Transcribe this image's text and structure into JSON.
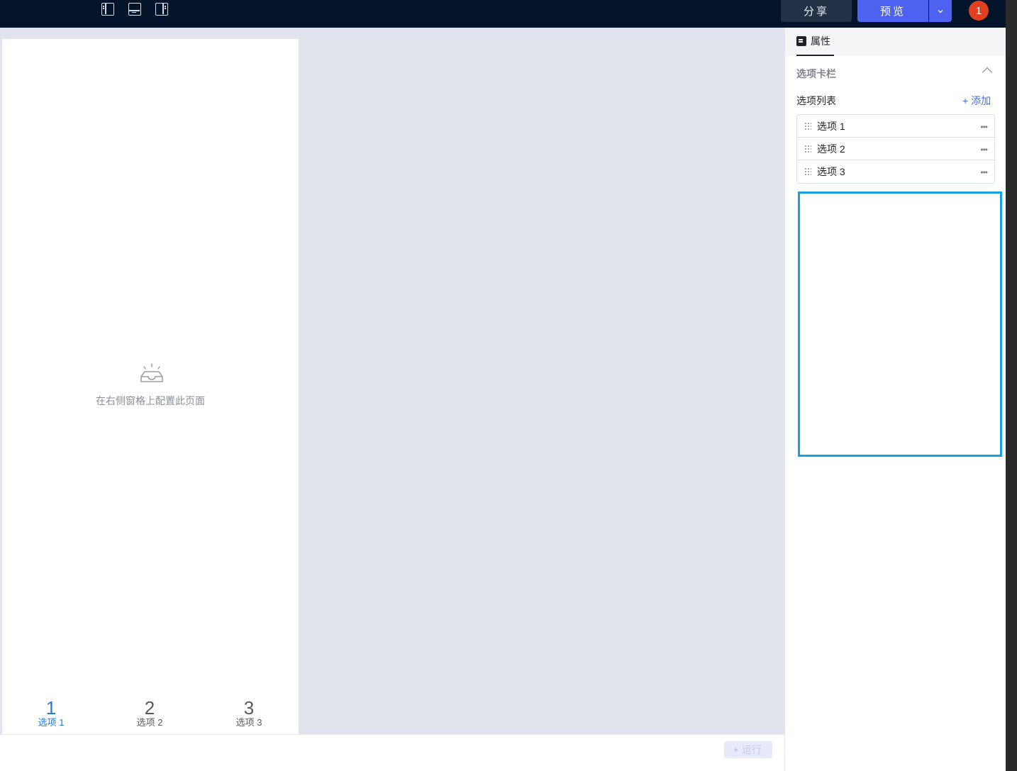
{
  "topbar": {
    "layout_icons": [
      "layout-left-panel-icon",
      "layout-bottom-panel-icon",
      "layout-right-panel-icon"
    ],
    "share_label": "分享",
    "preview_label": "预览",
    "preview_dropdown_icon": "chevron-down-icon",
    "avatar_text": "1",
    "colors": {
      "background": "#03142b",
      "primary": "#4d62f0",
      "avatar": "#e0401f"
    }
  },
  "canvas": {
    "empty_icon": "inbox-icon",
    "empty_text": "在右侧窗格上配置此页面",
    "tabbar": [
      {
        "num": "1",
        "label": "选项 1",
        "active": true
      },
      {
        "num": "2",
        "label": "选项 2",
        "active": false
      },
      {
        "num": "3",
        "label": "选项 3",
        "active": false
      }
    ],
    "accent_color": "#1e7be6"
  },
  "bottom_bar": {
    "run_label": "运行",
    "run_icon": "play-icon"
  },
  "right_panel": {
    "tab_label": "属性",
    "tab_icon": "properties-icon",
    "section_title": "选项卡栏",
    "collapse_icon": "chevron-up-icon",
    "list_label": "选项列表",
    "add_label": "+ 添加",
    "options": [
      {
        "label": "选项 1"
      },
      {
        "label": "选项 2"
      },
      {
        "label": "选项 3"
      }
    ],
    "highlight_color": "#14a2e3"
  }
}
